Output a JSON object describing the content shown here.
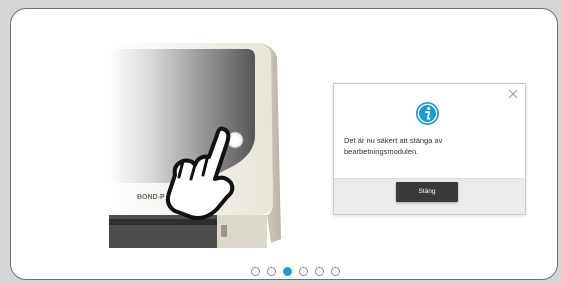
{
  "illustration": {
    "device_label": "BOND-P",
    "icon": "hand-press-icon"
  },
  "dialog": {
    "icon": "info-icon",
    "message": "Det är nu säkert att stänga av bearbetningsmodulen.",
    "button_label": "Stäng",
    "close_icon": "close-icon"
  },
  "pager": {
    "count": 6,
    "active_index": 2
  },
  "colors": {
    "accent": "#1d9ad9",
    "button": "#3a3a3a",
    "footer": "#ebebeb"
  }
}
